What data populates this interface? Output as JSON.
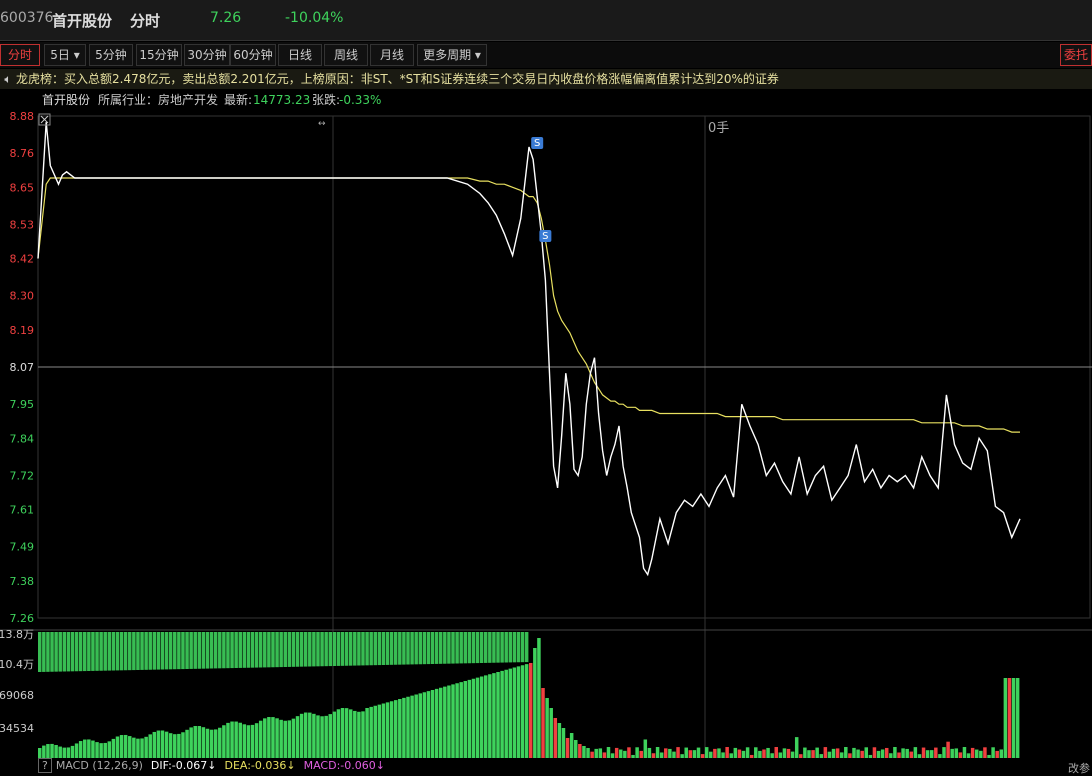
{
  "header": {
    "code": "600376",
    "name": "首开股份",
    "mode": "分时",
    "price": "7.26",
    "change": "-10.04%"
  },
  "tabs": [
    {
      "label": "分时",
      "active": true
    },
    {
      "label": "5日 ▾"
    },
    {
      "label": "5分钟"
    },
    {
      "label": "15分钟"
    },
    {
      "label": "30分钟"
    },
    {
      "label": "60分钟"
    },
    {
      "label": "日线"
    },
    {
      "label": "周线"
    },
    {
      "label": "月线"
    },
    {
      "label": "更多周期 ▾"
    }
  ],
  "entrust_label": "委托",
  "notice": {
    "icon": "speaker-icon",
    "text": "龙虎榜：买入总额2.478亿元，卖出总额2.201亿元，上榜原因：非ST、*ST和S证券连续三个交易日内收盘价格涨幅偏离值累计达到20%的证券"
  },
  "info": {
    "stock": "首开股份",
    "industry": "所属行业：房地产开发",
    "latest_label": "最新:",
    "latest_value": "14773.23",
    "change_label": "张跌:",
    "change_value": "-0.33%"
  },
  "volume_overlay_label": "0手",
  "markers": {
    "sell": "S"
  },
  "macd": {
    "help": "?",
    "label": "MACD (12,26,9)",
    "dif": "DIF:-0.067↓",
    "dea": "DEA:-0.036↓",
    "macd": "MACD:-0.060↓",
    "right_label": "改参"
  },
  "colors": {
    "up": "#f04040",
    "down": "#3ed25c",
    "avg": "#e8e060",
    "price": "#ffffff"
  },
  "chart_data": {
    "type": "line",
    "y_ticks": [
      "8.88",
      "8.76",
      "8.65",
      "8.53",
      "8.42",
      "8.30",
      "8.19",
      "8.07",
      "7.95",
      "7.84",
      "7.72",
      "7.61",
      "7.49",
      "7.38",
      "7.26"
    ],
    "ylim": [
      7.26,
      8.88
    ],
    "ref_price": 8.07,
    "volume_ticks": [
      "13.8万",
      "10.4万",
      "69068",
      "34534"
    ],
    "x": [
      0,
      2,
      3,
      4,
      5,
      6,
      7,
      8,
      9,
      10,
      20,
      30,
      40,
      50,
      60,
      70,
      80,
      90,
      100,
      105,
      108,
      110,
      112,
      114,
      116,
      118,
      120,
      121,
      122,
      123,
      124,
      125,
      126,
      127,
      128,
      129,
      130,
      131,
      132,
      133,
      134,
      135,
      136,
      137,
      138,
      139,
      140,
      141,
      142,
      143,
      144,
      145,
      146,
      147,
      148,
      149,
      150,
      152,
      154,
      156,
      158,
      160,
      162,
      164,
      166,
      168,
      170,
      172,
      174,
      176,
      178,
      180,
      182,
      184,
      186,
      188,
      190,
      192,
      194,
      196,
      198,
      200,
      202,
      204,
      206,
      208,
      210,
      212,
      214,
      216,
      218,
      220,
      222,
      224,
      226,
      228,
      230,
      232,
      234,
      236,
      238,
      240
    ],
    "price": [
      8.42,
      8.86,
      8.72,
      8.69,
      8.66,
      8.69,
      8.7,
      8.69,
      8.68,
      8.68,
      8.68,
      8.68,
      8.68,
      8.68,
      8.68,
      8.68,
      8.68,
      8.68,
      8.68,
      8.66,
      8.63,
      8.6,
      8.56,
      8.5,
      8.43,
      8.55,
      8.78,
      8.74,
      8.62,
      8.5,
      8.35,
      8.05,
      7.75,
      7.68,
      7.85,
      8.05,
      7.95,
      7.74,
      7.72,
      7.78,
      7.95,
      8.05,
      8.1,
      7.92,
      7.8,
      7.72,
      7.78,
      7.82,
      7.88,
      7.75,
      7.68,
      7.6,
      7.56,
      7.52,
      7.42,
      7.4,
      7.45,
      7.58,
      7.5,
      7.6,
      7.64,
      7.62,
      7.66,
      7.62,
      7.68,
      7.72,
      7.65,
      7.95,
      7.88,
      7.82,
      7.72,
      7.76,
      7.7,
      7.66,
      7.78,
      7.66,
      7.72,
      7.75,
      7.64,
      7.68,
      7.72,
      7.82,
      7.7,
      7.74,
      7.68,
      7.72,
      7.7,
      7.72,
      7.68,
      7.78,
      7.72,
      7.68,
      7.98,
      7.82,
      7.76,
      7.74,
      7.84,
      7.8,
      7.62,
      7.6,
      7.52,
      7.58,
      7.45
    ],
    "avg": [
      8.42,
      8.66,
      8.68,
      8.68,
      8.68,
      8.68,
      8.68,
      8.68,
      8.68,
      8.68,
      8.68,
      8.68,
      8.68,
      8.68,
      8.68,
      8.68,
      8.68,
      8.68,
      8.68,
      8.68,
      8.67,
      8.67,
      8.66,
      8.66,
      8.65,
      8.64,
      8.62,
      8.62,
      8.6,
      8.55,
      8.48,
      8.4,
      8.3,
      8.25,
      8.22,
      8.2,
      8.18,
      8.15,
      8.12,
      8.1,
      8.08,
      8.05,
      8.02,
      8.0,
      7.98,
      7.97,
      7.96,
      7.96,
      7.95,
      7.95,
      7.94,
      7.94,
      7.94,
      7.93,
      7.93,
      7.93,
      7.93,
      7.92,
      7.92,
      7.92,
      7.92,
      7.92,
      7.92,
      7.92,
      7.92,
      7.91,
      7.91,
      7.91,
      7.91,
      7.91,
      7.91,
      7.91,
      7.9,
      7.9,
      7.9,
      7.9,
      7.9,
      7.9,
      7.9,
      7.9,
      7.9,
      7.9,
      7.9,
      7.9,
      7.9,
      7.9,
      7.9,
      7.9,
      7.9,
      7.89,
      7.89,
      7.89,
      7.89,
      7.89,
      7.88,
      7.88,
      7.88,
      7.87,
      7.87,
      7.87,
      7.86,
      7.86,
      7.81
    ],
    "volume_max": 138000
  }
}
